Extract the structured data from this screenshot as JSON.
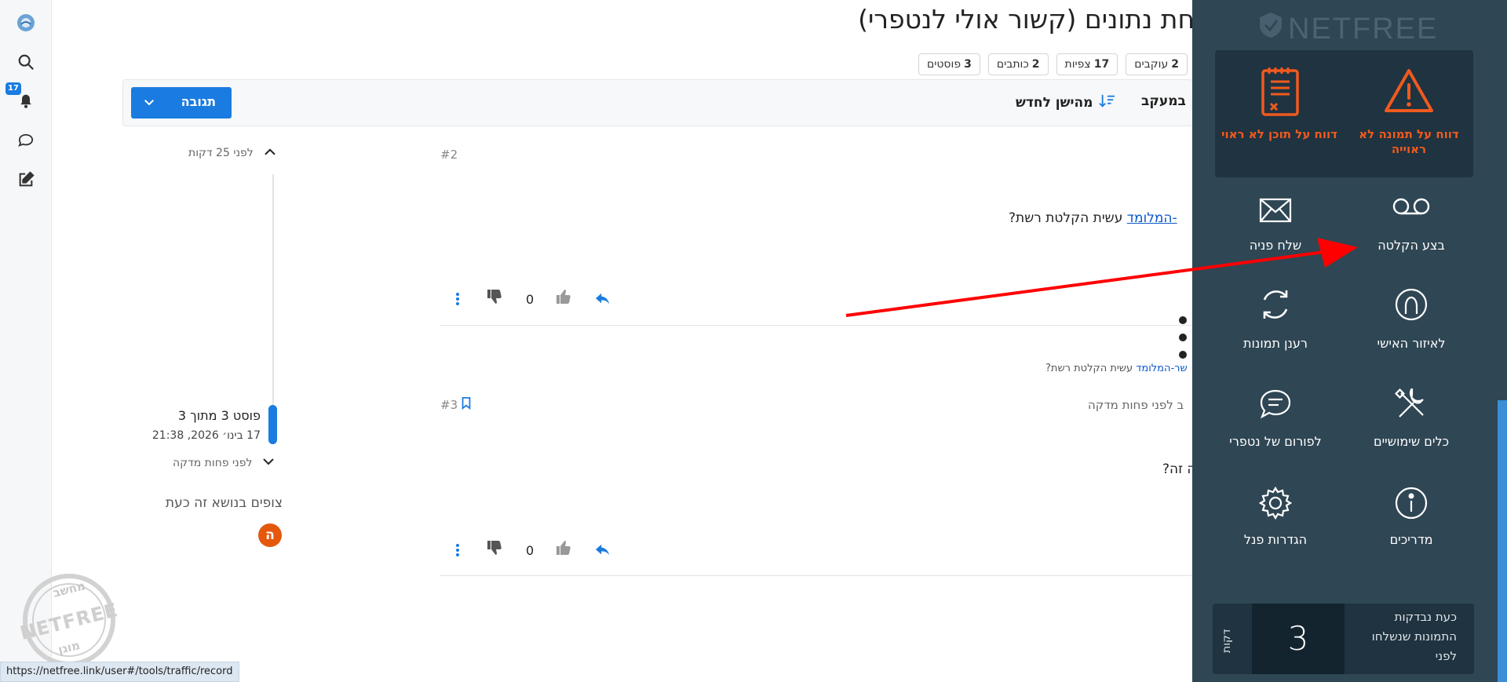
{
  "topic": {
    "title": "חת נתונים (קשור אולי לנטפרי)",
    "stats": [
      {
        "count": "3",
        "label": "פוסטים"
      },
      {
        "count": "2",
        "label": "כותבים"
      },
      {
        "count": "17",
        "label": "צפיות"
      },
      {
        "count": "2",
        "label": "עוקבים"
      }
    ]
  },
  "toolbar": {
    "reply_label": "תגובה",
    "sort_label": "מהישן לחדש",
    "follow_label": "במעקב"
  },
  "sidebar": {
    "notifications_badge": "17"
  },
  "timeline": {
    "top_label": "לפני 25 דקות",
    "post_label": "פוסט 3 מתוך 3",
    "post_date": "17 בינו׳ 2026, 21:38",
    "bottom_label": "לפני פחות מדקה",
    "watching_label": "צופים בנושא זה כעת",
    "avatar_letter": "ה"
  },
  "posts": [
    {
      "number": "#2",
      "link_text": "-המלומד",
      "body_text": "עשית הקלטת רשת?",
      "votes": "0"
    },
    {
      "number": "#3",
      "reply_link": "שר-המלומד",
      "reply_text": "עשית הקלטת רשת?",
      "time_text": "ב לפני פחות מדקה",
      "body_text": "ה זה?",
      "votes": "0"
    }
  ],
  "netfree_panel": {
    "logo_text": "NETFREE",
    "reports": [
      {
        "label": "דווח על תמונה לא ראוייה",
        "icon": "warning-icon"
      },
      {
        "label": "דווח על תוכן לא ראוי",
        "icon": "document-report-icon"
      }
    ],
    "tiles": [
      {
        "label": "בצע הקלטה",
        "icon": "record-icon"
      },
      {
        "label": "שלח פניה",
        "icon": "envelope-icon"
      },
      {
        "label": "לאיזור האישי",
        "icon": "user-icon"
      },
      {
        "label": "רענן תמונות",
        "icon": "refresh-icon"
      },
      {
        "label": "כלים שימושיים",
        "icon": "tools-icon"
      },
      {
        "label": "לפורום של נטפרי",
        "icon": "chat-icon"
      },
      {
        "label": "מדריכים",
        "icon": "info-icon"
      },
      {
        "label": "הגדרות פנל",
        "icon": "gear-icon"
      }
    ],
    "status": {
      "text_line1": "כעת נבדקות",
      "text_line2": "התמונות שנשלחו",
      "text_line3": "לפני",
      "value": "3",
      "unit": "דקות"
    }
  },
  "watermark": {
    "top": "מחשב",
    "middle": "NETFREE",
    "bottom": "מוגן"
  },
  "status_url": "https://netfree.link/user#/tools/traffic/record",
  "colors": {
    "accent": "#1a7ce0",
    "panel_bg": "#2f4654",
    "panel_dark": "#1f3340",
    "report_orange": "#f05a1e",
    "arrow_red": "#ff0000"
  }
}
